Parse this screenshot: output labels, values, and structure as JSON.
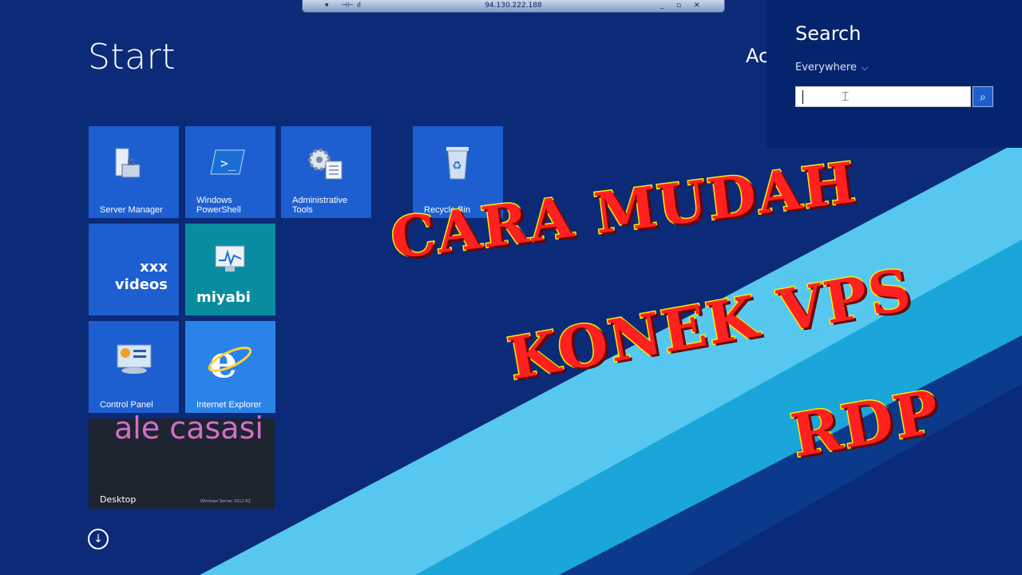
{
  "rdp_bar": {
    "ip": "94.130.222.188",
    "controls": [
      "▾",
      "⊣⊢",
      "ıl",
      "_",
      "▫",
      "✕"
    ]
  },
  "start": {
    "title": "Start",
    "user_partial": "Ac"
  },
  "tiles": {
    "server_manager": "Server Manager",
    "powershell": "Windows PowerShell",
    "admin_tools": "Administrative Tools",
    "recycle_bin": "Recycle Bin",
    "control_panel": "Control Panel",
    "internet_explorer": "Internet Explorer",
    "desktop": "Desktop",
    "desktop_sub": "Windows Server 2012 R2"
  },
  "overlays": {
    "xxx": "xxx",
    "videos": "videos",
    "miyabi": "miyabi",
    "ale": "ale casasi"
  },
  "search": {
    "title": "Search",
    "scope": "Everywhere",
    "value": "",
    "ibeam": "⌶",
    "button": "⌕"
  },
  "headline": [
    "CARA MUDAH",
    "KONEK VPS",
    "RDP"
  ],
  "colors": {
    "background": "#0b2a78",
    "tile": "#1d5fd0",
    "tile_teal": "#0a8ca0",
    "headline_fill": "#ff2020",
    "headline_stroke": "#f0f000"
  }
}
